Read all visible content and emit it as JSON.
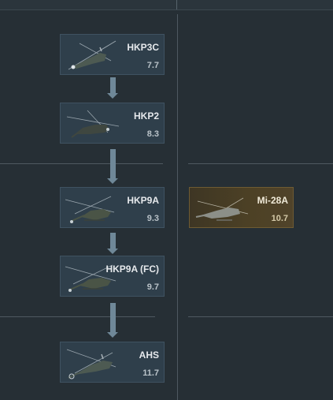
{
  "vehicles": [
    {
      "name": "HKP3C",
      "br": "7.7",
      "icon": "helicopter-icon",
      "premium": false
    },
    {
      "name": "HKP2",
      "br": "8.3",
      "icon": "helicopter-icon",
      "premium": false
    },
    {
      "name": "HKP9A",
      "br": "9.3",
      "icon": "helicopter-icon",
      "premium": false
    },
    {
      "name": "HKP9A (FC)",
      "br": "9.7",
      "icon": "helicopter-icon",
      "premium": false
    },
    {
      "name": "AHS",
      "br": "11.7",
      "icon": "helicopter-icon",
      "premium": false
    },
    {
      "name": "Mi-28A",
      "br": "10.7",
      "icon": "helicopter-icon",
      "premium": true
    }
  ],
  "colors": {
    "background": "#262f35",
    "card": "#2f3f4b",
    "premium_card": "#4d4125",
    "arrow": "#6f8898",
    "text": "#e6e9ec"
  }
}
